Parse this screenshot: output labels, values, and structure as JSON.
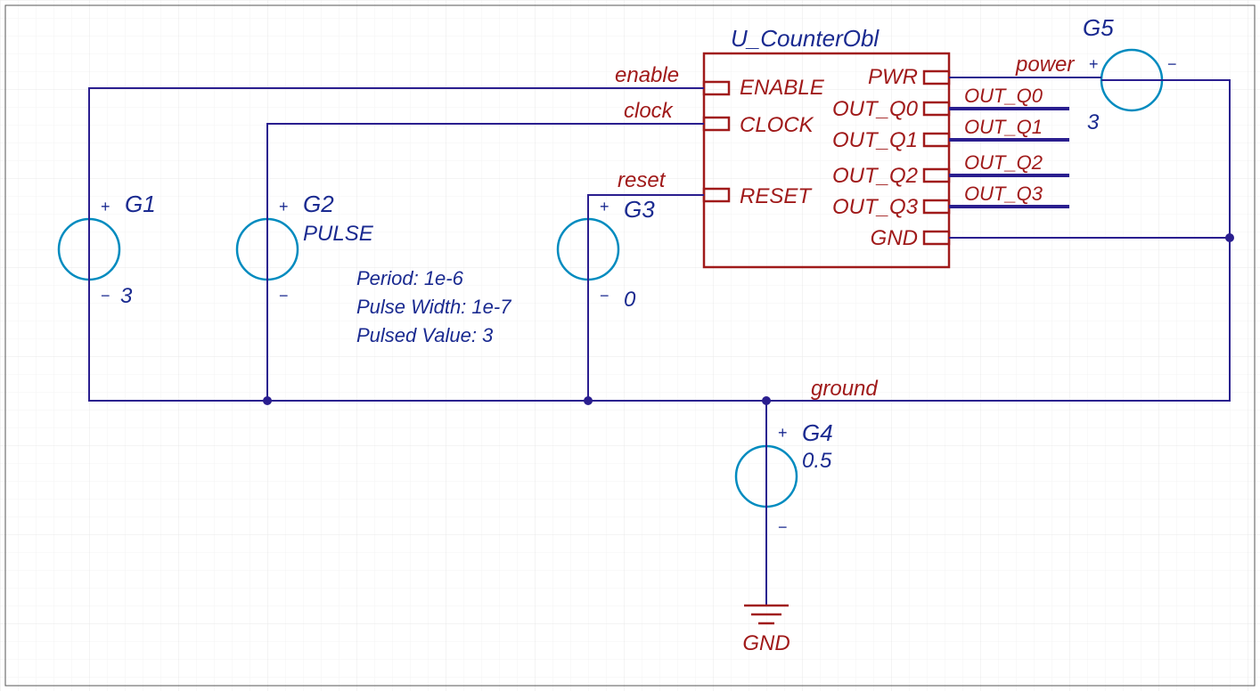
{
  "colors": {
    "wire": "#2a1e8f",
    "source": "#008bbf",
    "sheet": "#a01a1a",
    "text_blue": "#1a2a90",
    "text_red": "#a01a1a"
  },
  "sheet": {
    "name": "U_CounterObl",
    "left_ports": [
      "ENABLE",
      "CLOCK",
      "RESET"
    ],
    "right_ports": [
      "PWR",
      "OUT_Q0",
      "OUT_Q1",
      "OUT_Q2",
      "OUT_Q3",
      "GND"
    ]
  },
  "nets": {
    "enable": "enable",
    "clock": "clock",
    "reset": "reset",
    "power": "power",
    "ground": "ground",
    "out_q0": "OUT_Q0",
    "out_q1": "OUT_Q1",
    "out_q2": "OUT_Q2",
    "out_q3": "OUT_Q3"
  },
  "sources": {
    "G1": {
      "ref": "G1",
      "value": "3"
    },
    "G2": {
      "ref": "G2",
      "type": "PULSE",
      "period": "Period: 1e-6",
      "pw": "Pulse Width: 1e-7",
      "pv": "Pulsed Value: 3"
    },
    "G3": {
      "ref": "G3",
      "value": "0"
    },
    "G4": {
      "ref": "G4",
      "value": "0.5"
    },
    "G5": {
      "ref": "G5",
      "value": "3"
    }
  },
  "gnd_label": "GND"
}
